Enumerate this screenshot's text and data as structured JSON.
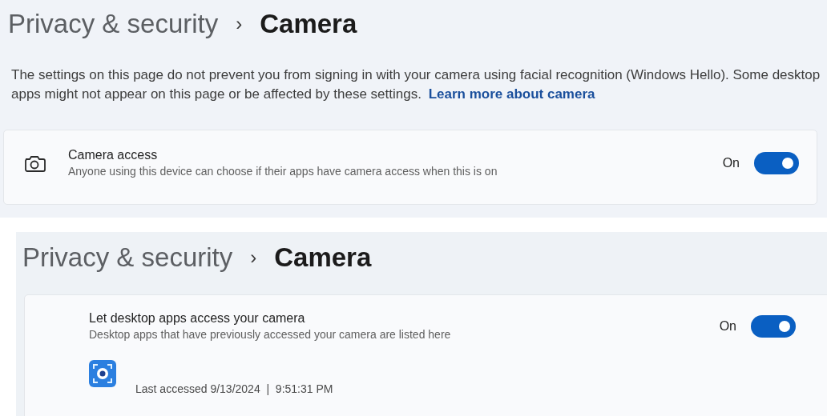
{
  "panels": [
    {
      "breadcrumb": {
        "parent": "Privacy & security",
        "separator": "›",
        "current": "Camera"
      },
      "notice": {
        "text": "The settings on this page do not prevent you from signing in with your camera using facial recognition (Windows Hello). Some desktop apps might not appear on this page or be affected by these settings.",
        "link": "Learn more about camera"
      },
      "setting": {
        "kind": "icon",
        "title": "Camera access",
        "description": "Anyone using this device can choose if their apps have camera access when this is on",
        "state_label": "On",
        "on": true
      }
    },
    {
      "breadcrumb": {
        "parent": "Privacy & security",
        "separator": "›",
        "current": "Camera"
      },
      "setting": {
        "kind": "indented",
        "title": "Let desktop apps access your camera",
        "description": "Desktop apps that have previously accessed your camera are listed here",
        "state_label": "On",
        "on": true
      },
      "app": {
        "accessed": "Last accessed 9/13/2024  |  9:51:31 PM"
      }
    }
  ]
}
